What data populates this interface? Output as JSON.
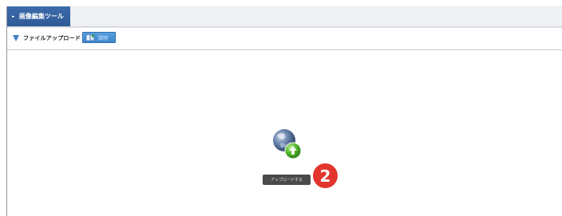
{
  "toolbar": {
    "tab_label": "画像編集ツール",
    "tab_marker": "►"
  },
  "section": {
    "title": "ファイルアップロード",
    "help_label": "説明"
  },
  "upload": {
    "button_label": "アップロードする"
  },
  "annotation": {
    "step_number": "2"
  },
  "colors": {
    "tab_blue": "#2f5a96",
    "help_blue": "#3d86cc",
    "badge_red": "#e2352d",
    "upload_button": "#4a4a4a"
  },
  "icons": {
    "collapse": "triangle-down-icon",
    "help": "book-icon",
    "upload": "globe-upload-icon"
  }
}
